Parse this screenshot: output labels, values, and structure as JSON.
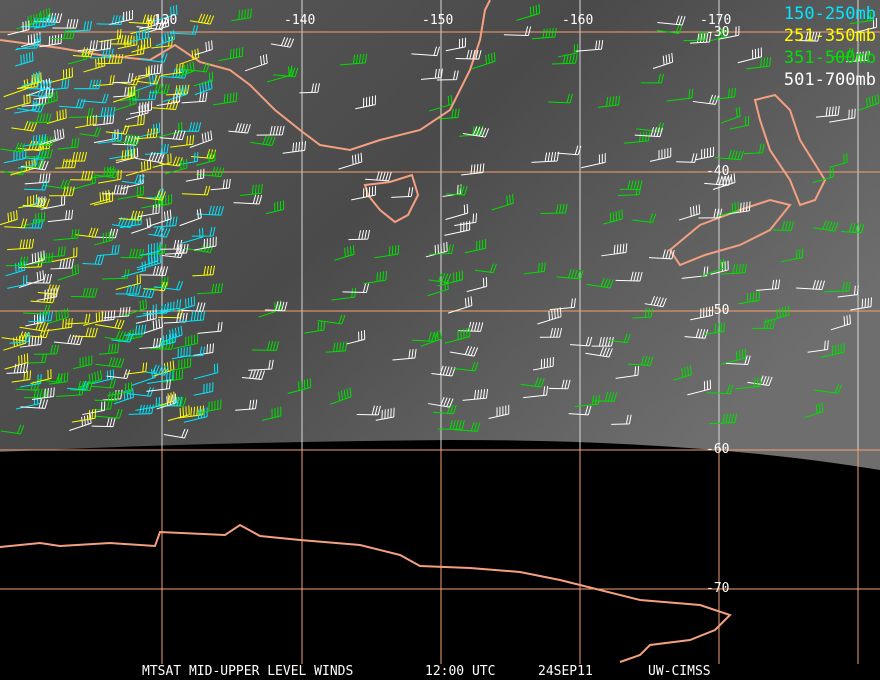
{
  "map": {
    "longitude_labels": [
      "-130",
      "-140",
      "-150",
      "-160",
      "-170"
    ],
    "latitude_labels": [
      "-30",
      "-40",
      "-50",
      "-60",
      "-70"
    ]
  },
  "legend": [
    {
      "label": "150-250mb",
      "color": "#00e8ff"
    },
    {
      "label": "251-350mb",
      "color": "#ffff00"
    },
    {
      "label": "351-500mb",
      "color": "#00e000"
    },
    {
      "label": "501-700mb",
      "color": "#ffffff"
    }
  ],
  "footer": {
    "product": "MTSAT MID-UPPER LEVEL WINDS",
    "time": "12:00 UTC",
    "date": "24SEP11",
    "source": "UW-CIMSS"
  },
  "colors": {
    "grid": "#f4a070",
    "coast": "#f4a080"
  }
}
